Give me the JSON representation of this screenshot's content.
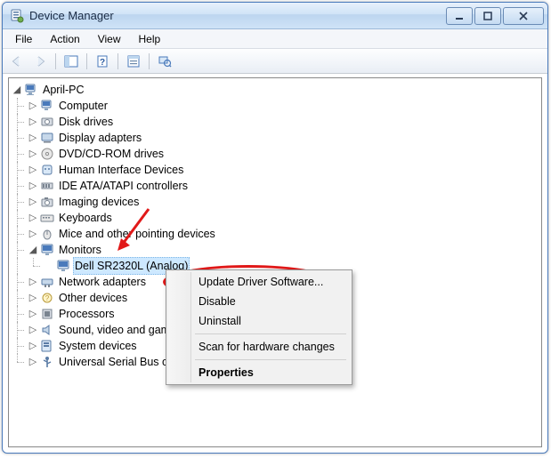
{
  "window": {
    "title": "Device Manager"
  },
  "menu": {
    "file": "File",
    "action": "Action",
    "view": "View",
    "help": "Help"
  },
  "tree": {
    "root": "April-PC",
    "nodes": [
      {
        "label": "Computer"
      },
      {
        "label": "Disk drives"
      },
      {
        "label": "Display adapters"
      },
      {
        "label": "DVD/CD-ROM drives"
      },
      {
        "label": "Human Interface Devices"
      },
      {
        "label": "IDE ATA/ATAPI controllers"
      },
      {
        "label": "Imaging devices"
      },
      {
        "label": "Keyboards"
      },
      {
        "label": "Mice and other pointing devices"
      },
      {
        "label": "Monitors"
      },
      {
        "label": "Network adapters"
      },
      {
        "label": "Other devices"
      },
      {
        "label": "Processors"
      },
      {
        "label": "Sound, video and game controllers"
      },
      {
        "label": "System devices"
      },
      {
        "label": "Universal Serial Bus controllers"
      }
    ],
    "monitors_child": "Dell SR2320L (Analog)"
  },
  "context_menu": {
    "update": "Update Driver Software...",
    "disable": "Disable",
    "uninstall": "Uninstall",
    "scan": "Scan for hardware changes",
    "properties": "Properties"
  }
}
